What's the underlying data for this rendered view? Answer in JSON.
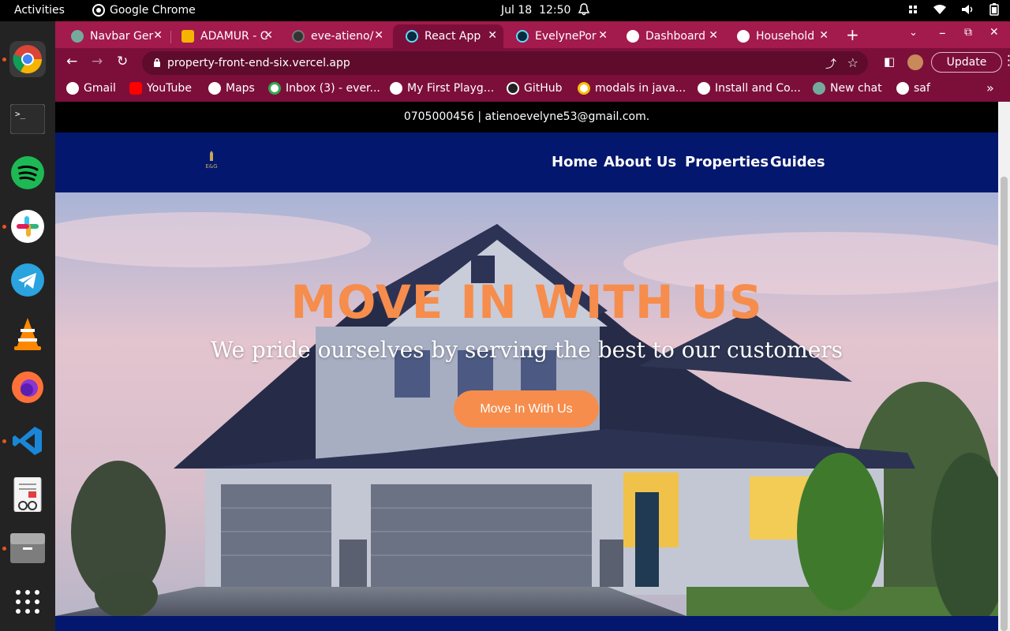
{
  "system": {
    "activities": "Activities",
    "app_name": "Google Chrome",
    "date": "Jul 18",
    "time": "12:50"
  },
  "dock": {
    "items": [
      "chrome-icon",
      "terminal-icon",
      "spotify-icon",
      "slack-icon",
      "telegram-icon",
      "vlc-icon",
      "firefox-icon",
      "vscode-icon",
      "document-viewer-icon",
      "files-icon",
      "app-grid-icon"
    ]
  },
  "browser": {
    "tabs": [
      {
        "title": "Navbar Ger",
        "active": false
      },
      {
        "title": "ADAMUR - C",
        "active": false
      },
      {
        "title": "eve-atieno/",
        "active": false
      },
      {
        "title": "React App",
        "active": true
      },
      {
        "title": "EvelynePor",
        "active": false
      },
      {
        "title": "Dashboard",
        "active": false
      },
      {
        "title": "Household",
        "active": false
      }
    ],
    "url": "property-front-end-six.vercel.app",
    "update_label": "Update",
    "bookmarks": [
      "Gmail",
      "YouTube",
      "Maps",
      "Inbox (3) - ever...",
      "My First Playg...",
      "GitHub",
      "modals in java...",
      "Install and Co...",
      "New chat",
      "saf"
    ]
  },
  "site": {
    "contact": "0705000456 | atienoevelyne53@gmail.com.",
    "logo_text": "E&G",
    "nav": {
      "home": "Home",
      "about": "About Us",
      "properties": "Properties",
      "guides": "Guides"
    },
    "hero": {
      "title": "MOVE IN WITH US",
      "subtitle": "We pride ourselves by serving the best to our customers",
      "cta": "Move In With Us"
    }
  },
  "colors": {
    "tab_strip": "#a31a4d",
    "toolbar": "#7c0f3a",
    "nav_bg": "#03176e",
    "accent": "#f68d4c"
  }
}
